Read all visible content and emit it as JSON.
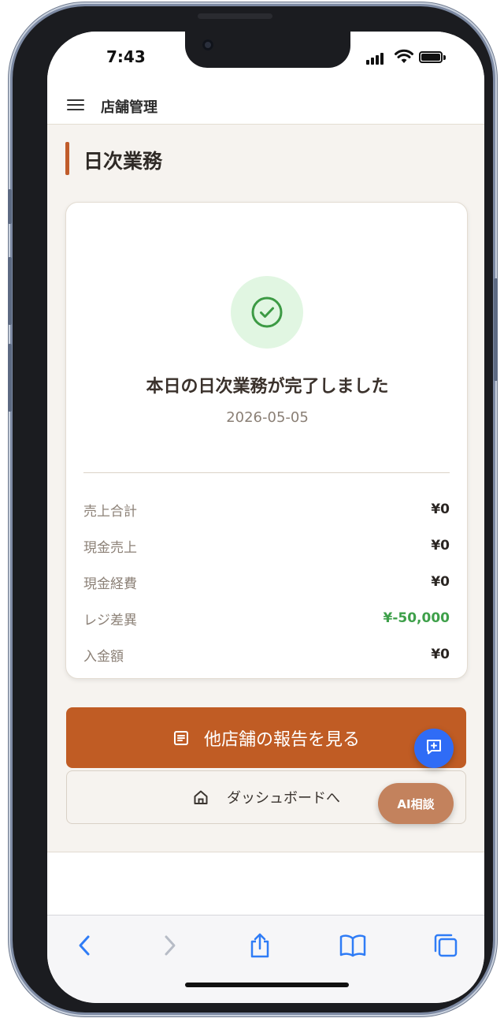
{
  "status_bar": {
    "time": "7:43"
  },
  "header": {
    "title": "店舗管理",
    "menu_icon": "hamburger-icon"
  },
  "page": {
    "title": "日次業務",
    "accent_color": "#c05c2b"
  },
  "completion_card": {
    "icon": "check-circle-icon",
    "message": "本日の日次業務が完了しました",
    "date": "2026-05-05",
    "summary": [
      {
        "label": "売上合計",
        "value": "¥0"
      },
      {
        "label": "現金売上",
        "value": "¥0"
      },
      {
        "label": "現金経費",
        "value": "¥0"
      },
      {
        "label": "レジ差異",
        "value": "¥-50,000",
        "status": "positive"
      },
      {
        "label": "入金額",
        "value": "¥0"
      }
    ]
  },
  "actions": {
    "view_reports_label": "他店舗の報告を見る",
    "view_reports_icon": "document-list-icon",
    "dashboard_label": "ダッシュボードへ",
    "dashboard_icon": "home-icon"
  },
  "floating": {
    "chat_icon": "chat-plus-icon",
    "ai_label": "AI相談"
  },
  "colors": {
    "primary": "#c05c24",
    "success": "#3ea04a",
    "fab_blue": "#2f6cf6",
    "ai_button": "#c3825d"
  },
  "toolbar": {
    "items": [
      "back-icon",
      "forward-icon",
      "share-icon",
      "bookmarks-icon",
      "tabs-icon"
    ]
  }
}
